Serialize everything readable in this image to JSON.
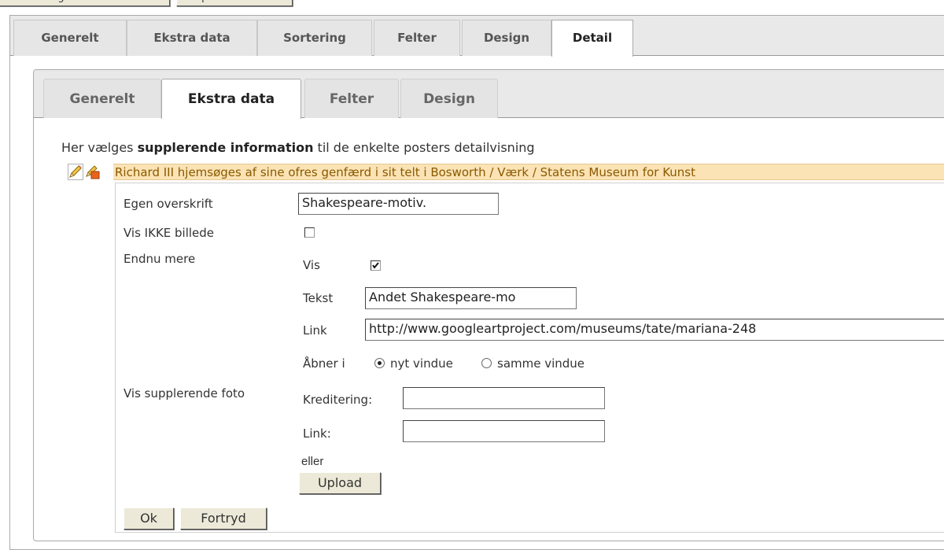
{
  "top_buttons": [
    "Gem konfiguration",
    "Vis preview"
  ],
  "main_tabs": [
    {
      "label": "Generelt",
      "active": false
    },
    {
      "label": "Ekstra data",
      "active": false
    },
    {
      "label": "Sortering",
      "active": false
    },
    {
      "label": "Felter",
      "active": false
    },
    {
      "label": "Design",
      "active": false
    },
    {
      "label": "Detail",
      "active": true
    }
  ],
  "detail_tabs": [
    {
      "label": "Generelt",
      "active": false
    },
    {
      "label": "Ekstra data",
      "active": true
    },
    {
      "label": "Felter",
      "active": false
    },
    {
      "label": "Design",
      "active": false
    }
  ],
  "intro": {
    "prefix": "Her vælges ",
    "bold": "supplerende information",
    "suffix": " til de enkelte posters detailvisning"
  },
  "item": {
    "title": "Richard III hjemsøges af sine ofres genfærd i sit telt i Bosworth / Værk / Statens Museum for Kunst",
    "icons": [
      "pencil-icon",
      "edit-pencil-icon"
    ]
  },
  "form": {
    "own_heading": {
      "label": "Egen overskrift",
      "value": "Shakespeare-motiv."
    },
    "hide_image": {
      "label": "Vis IKKE billede",
      "checked": false
    },
    "more": {
      "label": "Endnu mere",
      "show_label": "Vis",
      "show_checked": true,
      "text_label": "Tekst",
      "text_value": "Andet Shakespeare-mo",
      "link_label": "Link",
      "link_value": "http://www.googleartproject.com/museums/tate/mariana-248",
      "opens_label": "Åbner i",
      "options": [
        {
          "label": "nyt vindue",
          "selected": true
        },
        {
          "label": "samme vindue",
          "selected": false
        }
      ]
    },
    "extra_photo": {
      "label": "Vis supplerende foto",
      "credit_label": "Kreditering:",
      "credit_value": "",
      "link_label": "Link:",
      "link_value": "",
      "or_label": "eller",
      "upload_label": "Upload"
    }
  },
  "actions": {
    "ok": "Ok",
    "cancel": "Fortryd"
  }
}
